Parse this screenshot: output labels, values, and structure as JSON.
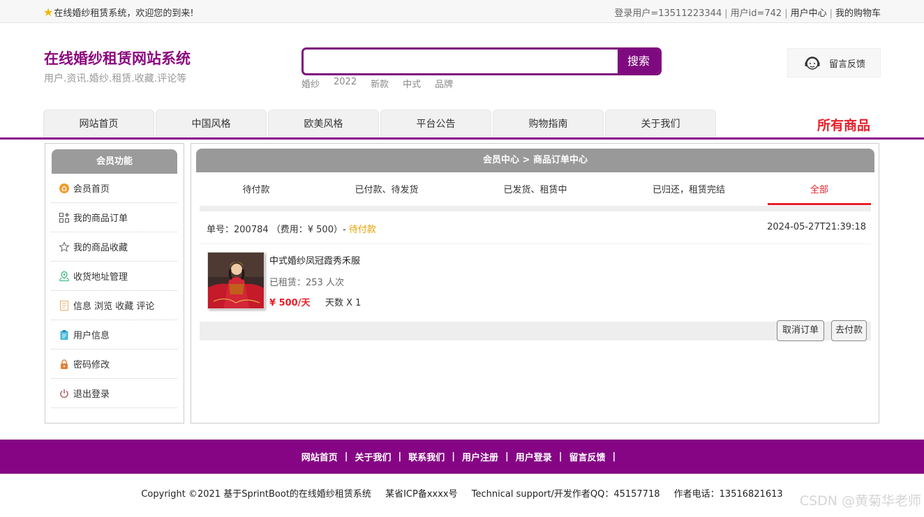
{
  "topbar": {
    "welcome": "在线婚纱租赁系统，欢迎您的到来!",
    "user_login": "登录用户=13511223344",
    "user_id": "用户id=742",
    "user_center": "用户中心",
    "cart": "我的购物车"
  },
  "brand": {
    "title": "在线婚纱租赁网站系统",
    "subtitle": "用户.资讯.婚纱.租赁.收藏.评论等"
  },
  "search": {
    "placeholder": "",
    "button": "搜索",
    "hotwords": [
      "婚纱",
      "2022",
      "新款",
      "中式",
      "品牌"
    ]
  },
  "feedback": {
    "label": "留言反馈",
    "icon": "customer-service-icon"
  },
  "nav": {
    "tabs": [
      "网站首页",
      "中国风格",
      "欧美风格",
      "平台公告",
      "购物指南",
      "关于我们"
    ],
    "all_goods": "所有商品"
  },
  "sidebar": {
    "title": "会员功能",
    "items": [
      {
        "label": "会员首页",
        "icon": "home-icon"
      },
      {
        "label": "我的商品订单",
        "icon": "grid-icon"
      },
      {
        "label": "我的商品收藏",
        "icon": "star-icon"
      },
      {
        "label": "收货地址管理",
        "icon": "location-icon"
      },
      {
        "label": "信息 浏览 收藏 评论",
        "icon": "document-icon"
      },
      {
        "label": "用户信息",
        "icon": "clipboard-icon"
      },
      {
        "label": "密码修改",
        "icon": "lock-icon"
      },
      {
        "label": "退出登录",
        "icon": "power-icon"
      }
    ]
  },
  "main": {
    "breadcrumb": "会员中心 > 商品订单中心",
    "tabs": [
      "待付款",
      "已付款、待发货",
      "已发货、租赁中",
      "已归还，租赁完结",
      "全部"
    ],
    "active_tab": "全部",
    "order": {
      "number_prefix": "单号：200784 （费用：¥ 500）-",
      "status": "待付款",
      "time": "2024-05-27T21:39:18",
      "product_name": "中式婚纱凤冠霞秀禾服",
      "rented": "已租赁：253 人次",
      "price": "¥ 500/天",
      "days": "天数 X 1",
      "cancel_button": "取消订单",
      "pay_button": "去付款"
    }
  },
  "footer": {
    "links": [
      "网站首页",
      "关于我们",
      "联系我们",
      "用户注册",
      "用户登录",
      "留言反馈"
    ],
    "copyright": "Copyright ©2021 基于SprintBoot的在线婚纱租赁系统",
    "icp": "某省ICP备xxxx号",
    "support": "Technical support/开发作者QQ：45157718",
    "phone": "作者电话：13516821613",
    "watermark": "CSDN @黄菊华老师"
  },
  "colors": {
    "brand_purple": "#8b0a7e",
    "accent_red": "#e8202a",
    "pending_orange": "#e6a100"
  }
}
